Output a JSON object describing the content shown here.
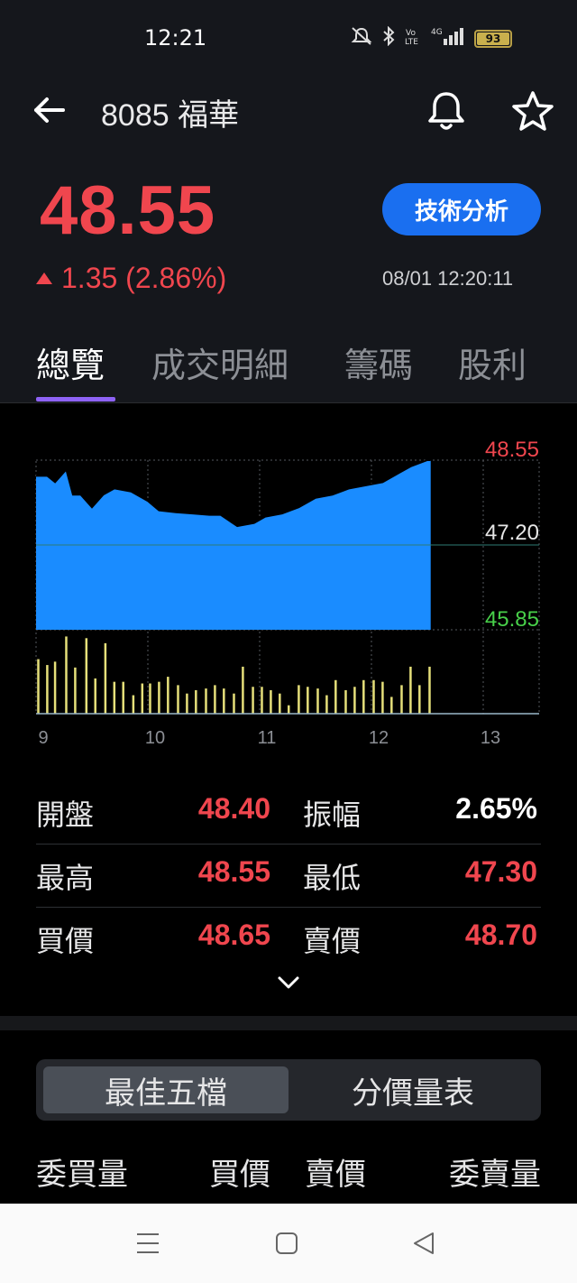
{
  "status": {
    "time": "12:21",
    "battery": "93"
  },
  "header": {
    "title": "8085 福華"
  },
  "quote": {
    "price": "48.55",
    "change": "1.35 (2.86%)",
    "timestamp": "08/01 12:20:11",
    "ta_button": "技術分析"
  },
  "tabs": [
    "總覽",
    "成交明細",
    "籌碼",
    "股利"
  ],
  "colors": {
    "up": "#f0464e",
    "down": "#48d04a",
    "area": "#1a8cff",
    "volume": "#e6e07a",
    "accent": "#1a6ff0",
    "tab_active": "#8e62f5"
  },
  "chart_data": {
    "type": "area",
    "price_labels": {
      "high": "48.55",
      "ref": "47.20",
      "low": "45.85"
    },
    "ylim": [
      45.85,
      48.55
    ],
    "reference": 47.2,
    "x_ticks": [
      "9",
      "10",
      "11",
      "12",
      "13"
    ],
    "x_range": [
      9,
      13.5
    ],
    "price_series": [
      [
        9.0,
        48.3
      ],
      [
        9.1,
        48.3
      ],
      [
        9.17,
        48.2
      ],
      [
        9.27,
        48.4
      ],
      [
        9.33,
        48.0
      ],
      [
        9.4,
        48.0
      ],
      [
        9.5,
        47.8
      ],
      [
        9.6,
        48.0
      ],
      [
        9.7,
        48.1
      ],
      [
        9.85,
        48.05
      ],
      [
        10.0,
        47.9
      ],
      [
        10.1,
        47.75
      ],
      [
        10.25,
        47.72
      ],
      [
        10.4,
        47.7
      ],
      [
        10.55,
        47.68
      ],
      [
        10.65,
        47.68
      ],
      [
        10.8,
        47.5
      ],
      [
        10.95,
        47.55
      ],
      [
        11.05,
        47.65
      ],
      [
        11.2,
        47.7
      ],
      [
        11.35,
        47.8
      ],
      [
        11.5,
        47.95
      ],
      [
        11.65,
        48.0
      ],
      [
        11.8,
        48.1
      ],
      [
        11.95,
        48.15
      ],
      [
        12.1,
        48.2
      ],
      [
        12.25,
        48.35
      ],
      [
        12.35,
        48.45
      ],
      [
        12.5,
        48.55
      ],
      [
        12.53,
        48.55
      ]
    ],
    "volume_series": [
      [
        9.02,
        65
      ],
      [
        9.1,
        58
      ],
      [
        9.17,
        62
      ],
      [
        9.27,
        92
      ],
      [
        9.35,
        55
      ],
      [
        9.45,
        90
      ],
      [
        9.53,
        42
      ],
      [
        9.62,
        84
      ],
      [
        9.7,
        38
      ],
      [
        9.78,
        38
      ],
      [
        9.87,
        22
      ],
      [
        9.95,
        36
      ],
      [
        10.02,
        36
      ],
      [
        10.1,
        38
      ],
      [
        10.18,
        44
      ],
      [
        10.27,
        34
      ],
      [
        10.35,
        24
      ],
      [
        10.43,
        28
      ],
      [
        10.52,
        30
      ],
      [
        10.6,
        34
      ],
      [
        10.68,
        30
      ],
      [
        10.77,
        24
      ],
      [
        10.85,
        56
      ],
      [
        10.94,
        32
      ],
      [
        11.02,
        32
      ],
      [
        11.1,
        28
      ],
      [
        11.18,
        24
      ],
      [
        11.26,
        10
      ],
      [
        11.35,
        34
      ],
      [
        11.43,
        32
      ],
      [
        11.52,
        30
      ],
      [
        11.6,
        22
      ],
      [
        11.68,
        40
      ],
      [
        11.77,
        28
      ],
      [
        11.85,
        32
      ],
      [
        11.93,
        40
      ],
      [
        12.02,
        40
      ],
      [
        12.1,
        38
      ],
      [
        12.18,
        20
      ],
      [
        12.27,
        34
      ],
      [
        12.35,
        56
      ],
      [
        12.43,
        34
      ],
      [
        12.52,
        56
      ]
    ],
    "volume_max": 100
  },
  "stats": [
    {
      "l1": "開盤",
      "v1": "48.40",
      "l2": "振幅",
      "v2": "2.65%"
    },
    {
      "l1": "最高",
      "v1": "48.55",
      "l2": "最低",
      "v2": "47.30"
    },
    {
      "l1": "買價",
      "v1": "48.65",
      "l2": "賣價",
      "v2": "48.70"
    }
  ],
  "segment": {
    "active": "最佳五檔",
    "inactive": "分價量表"
  },
  "orderbook_headers": {
    "bid_qty": "委買量",
    "bid_price": "買價",
    "ask_price": "賣價",
    "ask_qty": "委賣量"
  }
}
